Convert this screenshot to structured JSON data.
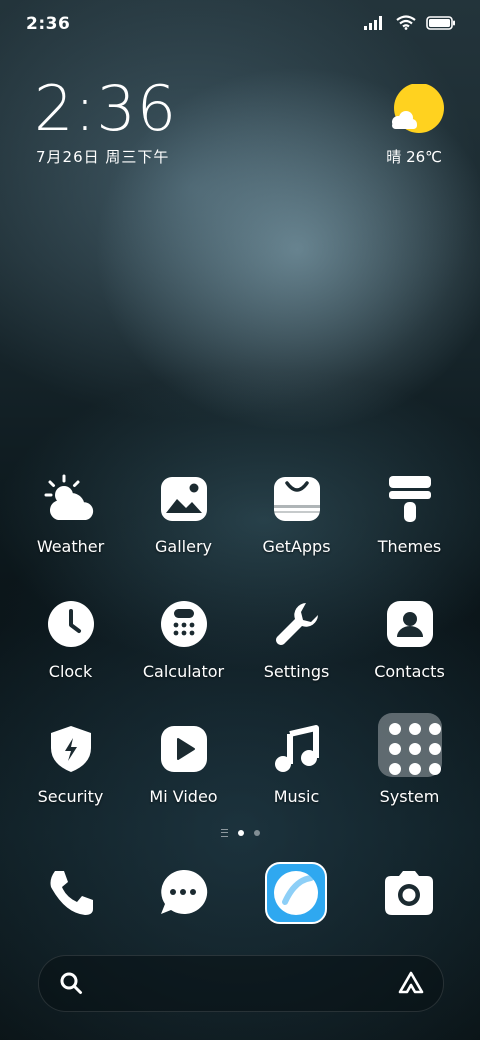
{
  "status_bar": {
    "time": "2:36",
    "icons": [
      "signal-icon",
      "wifi-icon",
      "battery-icon"
    ]
  },
  "clock_widget": {
    "time": "2:36",
    "date": "7月26日 周三下午"
  },
  "weather_widget": {
    "condition_temp": "晴 26℃",
    "icon": "sun-cloud-icon",
    "sun_color": "#FFD21F"
  },
  "apps": [
    {
      "label": "Weather",
      "icon": "weather-icon"
    },
    {
      "label": "Gallery",
      "icon": "gallery-icon"
    },
    {
      "label": "GetApps",
      "icon": "getapps-icon"
    },
    {
      "label": "Themes",
      "icon": "themes-icon"
    },
    {
      "label": "Clock",
      "icon": "clock-icon"
    },
    {
      "label": "Calculator",
      "icon": "calculator-icon"
    },
    {
      "label": "Settings",
      "icon": "wrench-icon"
    },
    {
      "label": "Contacts",
      "icon": "contacts-icon"
    },
    {
      "label": "Security",
      "icon": "shield-icon"
    },
    {
      "label": "Mi Video",
      "icon": "play-icon"
    },
    {
      "label": "Music",
      "icon": "music-note-icon"
    },
    {
      "label": "System",
      "icon": "folder-icon"
    }
  ],
  "page_indicator": {
    "pages": 3,
    "active": 2
  },
  "dock": [
    {
      "icon": "phone-icon"
    },
    {
      "icon": "messages-icon"
    },
    {
      "icon": "browser-icon",
      "accent": "#2FA8F0"
    },
    {
      "icon": "camera-icon"
    }
  ],
  "search_bar": {
    "icon": "search-icon",
    "assistant_icon": "assistant-icon"
  }
}
